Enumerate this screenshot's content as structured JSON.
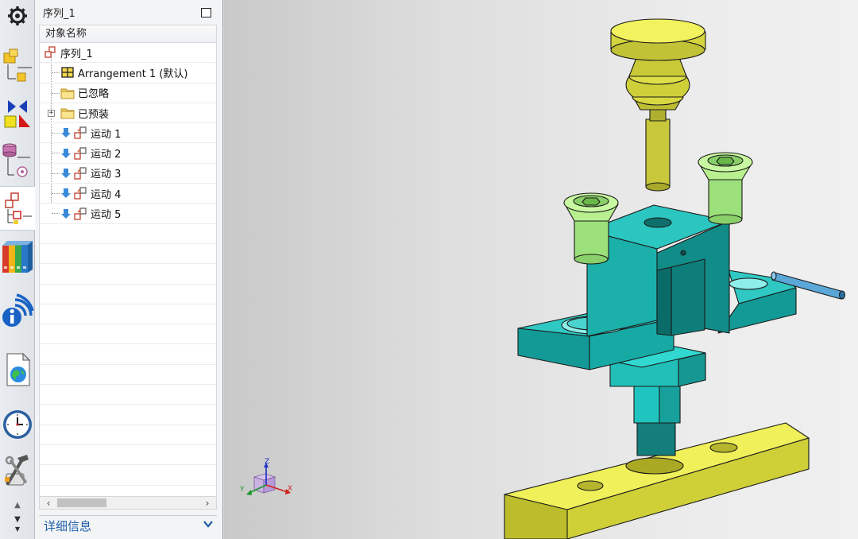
{
  "navigator": {
    "title": "序列_1",
    "column_header": "对象名称",
    "root": "序列_1",
    "items": [
      {
        "label": "Arrangement 1 (默认)",
        "type": "arrangement"
      },
      {
        "label": "已忽略",
        "type": "folder"
      },
      {
        "label": "已预装",
        "type": "folder",
        "expandable": true
      },
      {
        "label": "运动 1",
        "type": "motion"
      },
      {
        "label": "运动 2",
        "type": "motion"
      },
      {
        "label": "运动 3",
        "type": "motion"
      },
      {
        "label": "运动 4",
        "type": "motion"
      },
      {
        "label": "运动 5",
        "type": "motion"
      }
    ],
    "details_label": "详细信息"
  },
  "resource_bar": [
    {
      "name": "roles-gear-icon"
    },
    {
      "name": "assembly-navigator-icon"
    },
    {
      "name": "constraint-navigator-icon"
    },
    {
      "name": "part-navigator-icon"
    },
    {
      "name": "sequence-navigator-icon",
      "active": true
    },
    {
      "name": "reuse-library-icon"
    },
    {
      "name": "info-icon"
    },
    {
      "name": "web-browser-icon"
    },
    {
      "name": "history-clock-icon"
    },
    {
      "name": "process-studio-tools-icon"
    }
  ],
  "triad": {
    "x": "X",
    "y": "Y",
    "z": "Z"
  },
  "colors": {
    "accent_blue": "#1f5fa8",
    "part_yellow": "#e8e84e",
    "part_teal": "#1a9e9a",
    "part_green": "#9be07a"
  }
}
